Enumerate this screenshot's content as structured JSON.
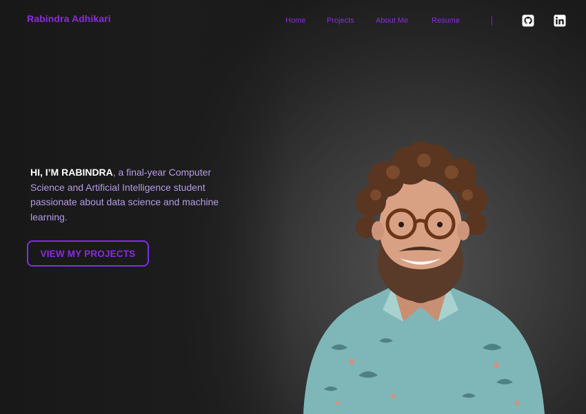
{
  "header": {
    "brand": "Rabindra Adhikari",
    "nav": [
      "Home",
      "Projects",
      "About Me",
      "Resume"
    ],
    "social_icons": [
      "github-icon",
      "linkedin-icon"
    ]
  },
  "hero": {
    "greeting": "HI, I’M RABINDRA",
    "intro": ", a final-year Computer Science  and Artificial Intelligence student passionate about data science and machine learning.",
    "cta_label": "VIEW MY PROJECTS"
  },
  "colors": {
    "accent": "#8a2be2",
    "background": "#1c1c1c",
    "text_light": "#b79be8"
  }
}
